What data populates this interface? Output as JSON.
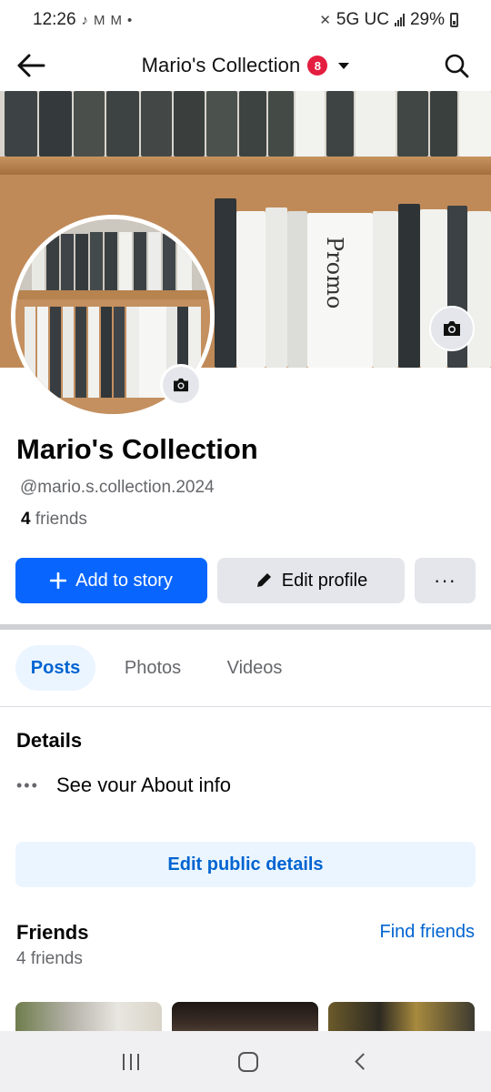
{
  "status_bar": {
    "time": "12:26",
    "network": "5G UC",
    "battery": "29%"
  },
  "header": {
    "title": "Mario's Collection",
    "notification_count": "8",
    "back_icon": "arrow-left-icon",
    "search_icon": "search-icon"
  },
  "cover": {
    "binder_label": "Promo",
    "camera_icon": "camera-icon"
  },
  "profile": {
    "name": "Mario's Collection",
    "handle": "@mario.s.collection.2024",
    "friends_count": "4",
    "friends_word": "friends"
  },
  "actions": {
    "add_to_story": "Add to story",
    "edit_profile": "Edit profile",
    "more": "···"
  },
  "tabs": [
    {
      "label": "Posts",
      "active": true
    },
    {
      "label": "Photos",
      "active": false
    },
    {
      "label": "Videos",
      "active": false
    }
  ],
  "details": {
    "title": "Details",
    "about_text": "See vour About info",
    "edit_public_details": "Edit public details"
  },
  "friends": {
    "title": "Friends",
    "find_friends": "Find friends",
    "count_text": "4 friends"
  },
  "colors": {
    "accent": "#0866ff",
    "link": "#0064d1",
    "badge": "#e41e3f",
    "tab_active_bg": "#ebf5ff",
    "secondary_bg": "#e4e6eb"
  }
}
